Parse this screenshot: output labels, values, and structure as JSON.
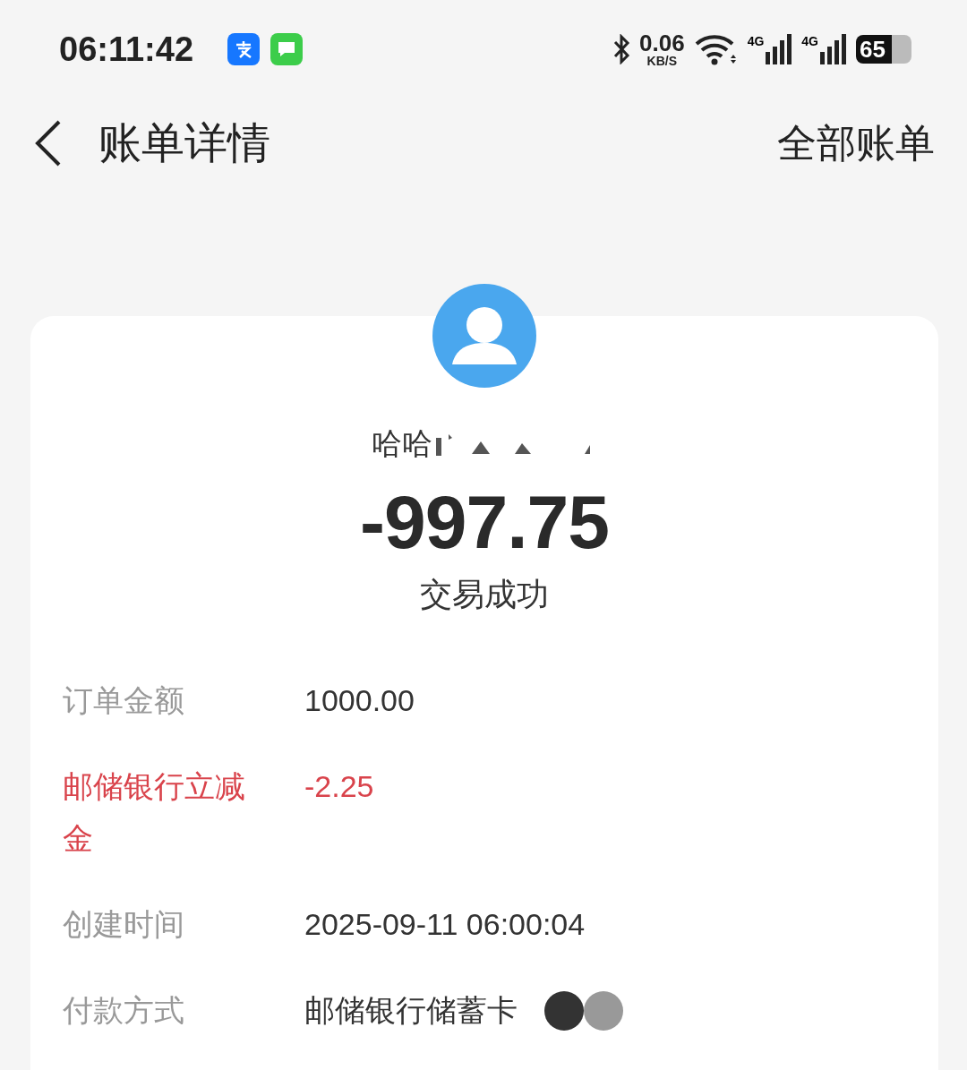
{
  "status_bar": {
    "time": "06:11:42",
    "net_speed": "0.06",
    "net_unit": "KB/S",
    "network_1": "4G",
    "network_2": "4G",
    "battery": "65"
  },
  "header": {
    "title": "账单详情",
    "action": "全部账单"
  },
  "payee": {
    "name": "哈哈",
    "amount": "-997.75",
    "status": "交易成功"
  },
  "details": [
    {
      "kind": "normal",
      "label": "订单金额",
      "value": "1000.00"
    },
    {
      "kind": "discount",
      "label": "邮储银行立减金",
      "value": "-2.25"
    },
    {
      "kind": "normal",
      "label": "创建时间",
      "value": "2025-09-11 06:00:04"
    },
    {
      "kind": "redacted",
      "label": "付款方式",
      "value": "邮储银行储蓄卡"
    }
  ]
}
